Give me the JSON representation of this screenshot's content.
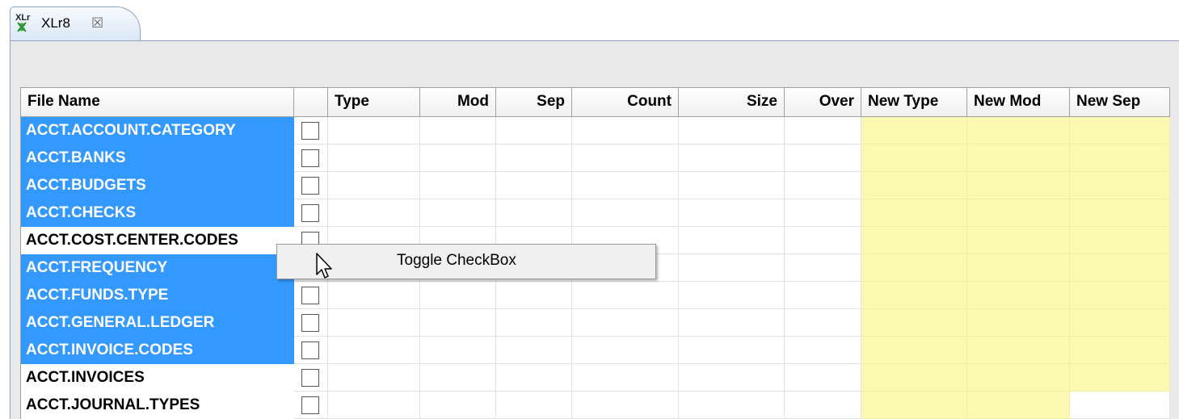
{
  "tab": {
    "icon_text": "XLr",
    "label": "XLr8",
    "close": "☒"
  },
  "table": {
    "headers": [
      "File Name",
      "",
      "Type",
      "Mod",
      "Sep",
      "Count",
      "Size",
      "Over",
      "New Type",
      "New Mod",
      "New Sep"
    ],
    "rows": [
      {
        "name": "ACCT.ACCOUNT.CATEGORY",
        "selected": true
      },
      {
        "name": "ACCT.BANKS",
        "selected": true
      },
      {
        "name": "ACCT.BUDGETS",
        "selected": true
      },
      {
        "name": "ACCT.CHECKS",
        "selected": true
      },
      {
        "name": "ACCT.COST.CENTER.CODES",
        "selected": false
      },
      {
        "name": "ACCT.FREQUENCY",
        "selected": true
      },
      {
        "name": "ACCT.FUNDS.TYPE",
        "selected": true
      },
      {
        "name": "ACCT.GENERAL.LEDGER",
        "selected": true
      },
      {
        "name": "ACCT.INVOICE.CODES",
        "selected": true
      },
      {
        "name": "ACCT.INVOICES",
        "selected": false
      },
      {
        "name": "ACCT.JOURNAL.TYPES",
        "selected": false
      }
    ]
  },
  "context_menu": {
    "items": [
      "Toggle CheckBox"
    ]
  },
  "colors": {
    "selection": "#3399ff",
    "editable_column": "#fbf8b1"
  }
}
